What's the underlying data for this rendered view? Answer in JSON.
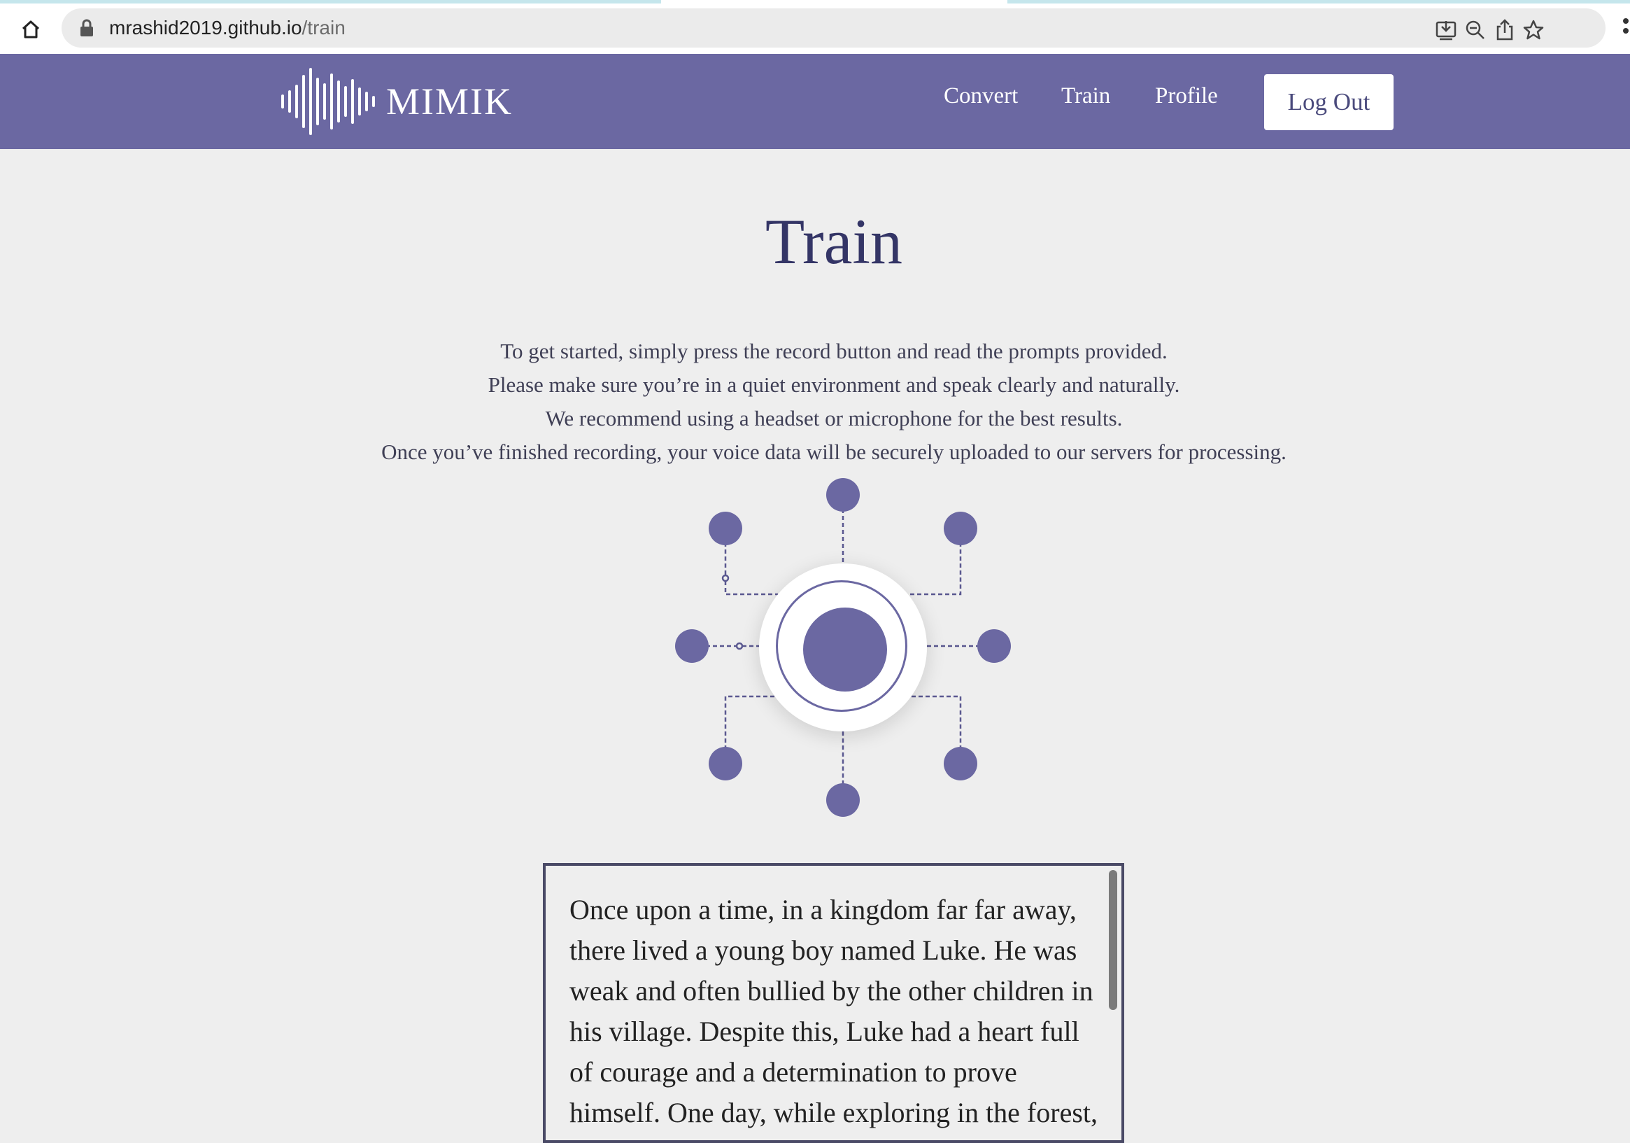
{
  "browser": {
    "url_host": "mrashid2019.github.io",
    "url_path": "/train",
    "toolbar_icons": [
      "download-icon",
      "zoom-out-icon",
      "share-icon",
      "bookmark-star-icon"
    ]
  },
  "site": {
    "logo_text": "MIMIK",
    "nav": {
      "convert": "Convert",
      "train": "Train",
      "profile": "Profile",
      "logout": "Log Out"
    }
  },
  "page": {
    "title": "Train",
    "intro": [
      "To get started, simply press the record button and read the prompts provided.",
      "Please make sure you’re in a quiet environment and speak clearly and naturally.",
      "We recommend using a headset or microphone for the best results.",
      "Once you’ve finished recording, your voice data will be securely uploaded to our servers for processing."
    ],
    "prompt_text": "Once upon a time, in a kingdom far far away, there lived a young boy named Luke. He was weak and often bullied by the other children in his village. Despite this, Luke had a heart full of courage and a determination to prove himself. One day, while exploring in the forest, Luke stumbled upon"
  },
  "colors": {
    "brand": "#6b68a2",
    "title": "#343566",
    "background": "#eeeeee"
  }
}
